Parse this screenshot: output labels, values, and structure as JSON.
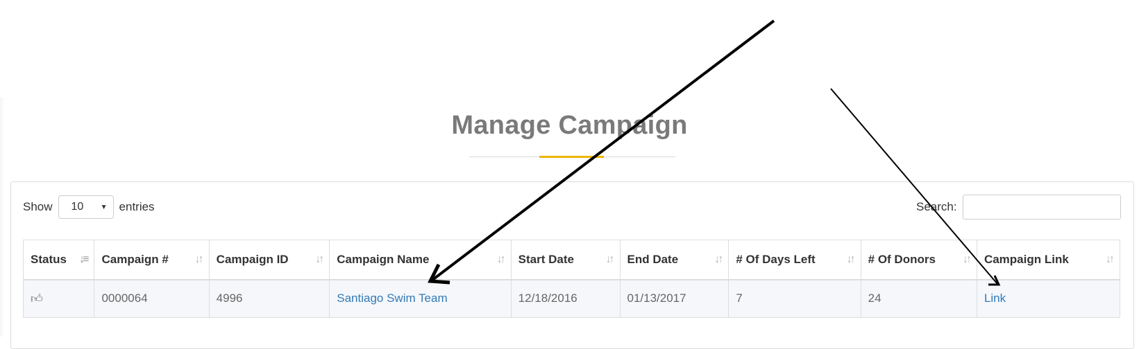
{
  "page": {
    "title": "Manage Campaign",
    "accent_color": "#f0b400",
    "link_color": "#337ab7"
  },
  "length_control": {
    "prefix": "Show",
    "value": "10",
    "suffix": "entries"
  },
  "search": {
    "label": "Search:",
    "value": ""
  },
  "table": {
    "columns": [
      {
        "label": "Status",
        "sort_icon": "sort-amount-asc-icon"
      },
      {
        "label": "Campaign #",
        "sort_icon": "sort-both-icon"
      },
      {
        "label": "Campaign ID",
        "sort_icon": "sort-both-icon"
      },
      {
        "label": "Campaign Name",
        "sort_icon": "sort-both-icon"
      },
      {
        "label": "Start Date",
        "sort_icon": "sort-both-icon"
      },
      {
        "label": "End Date",
        "sort_icon": "sort-both-icon"
      },
      {
        "label": "# Of Days Left",
        "sort_icon": "sort-both-icon"
      },
      {
        "label": "# Of Donors",
        "sort_icon": "sort-both-icon"
      },
      {
        "label": "Campaign Link",
        "sort_icon": "sort-both-icon"
      }
    ],
    "rows": [
      {
        "status_icon": "thumbs-up-icon",
        "campaign_number": "0000064",
        "campaign_id": "4996",
        "campaign_name": "Santiago Swim Team",
        "start_date": "12/18/2016",
        "end_date": "01/13/2017",
        "days_left": "7",
        "donors": "24",
        "campaign_link": "Link"
      }
    ]
  }
}
